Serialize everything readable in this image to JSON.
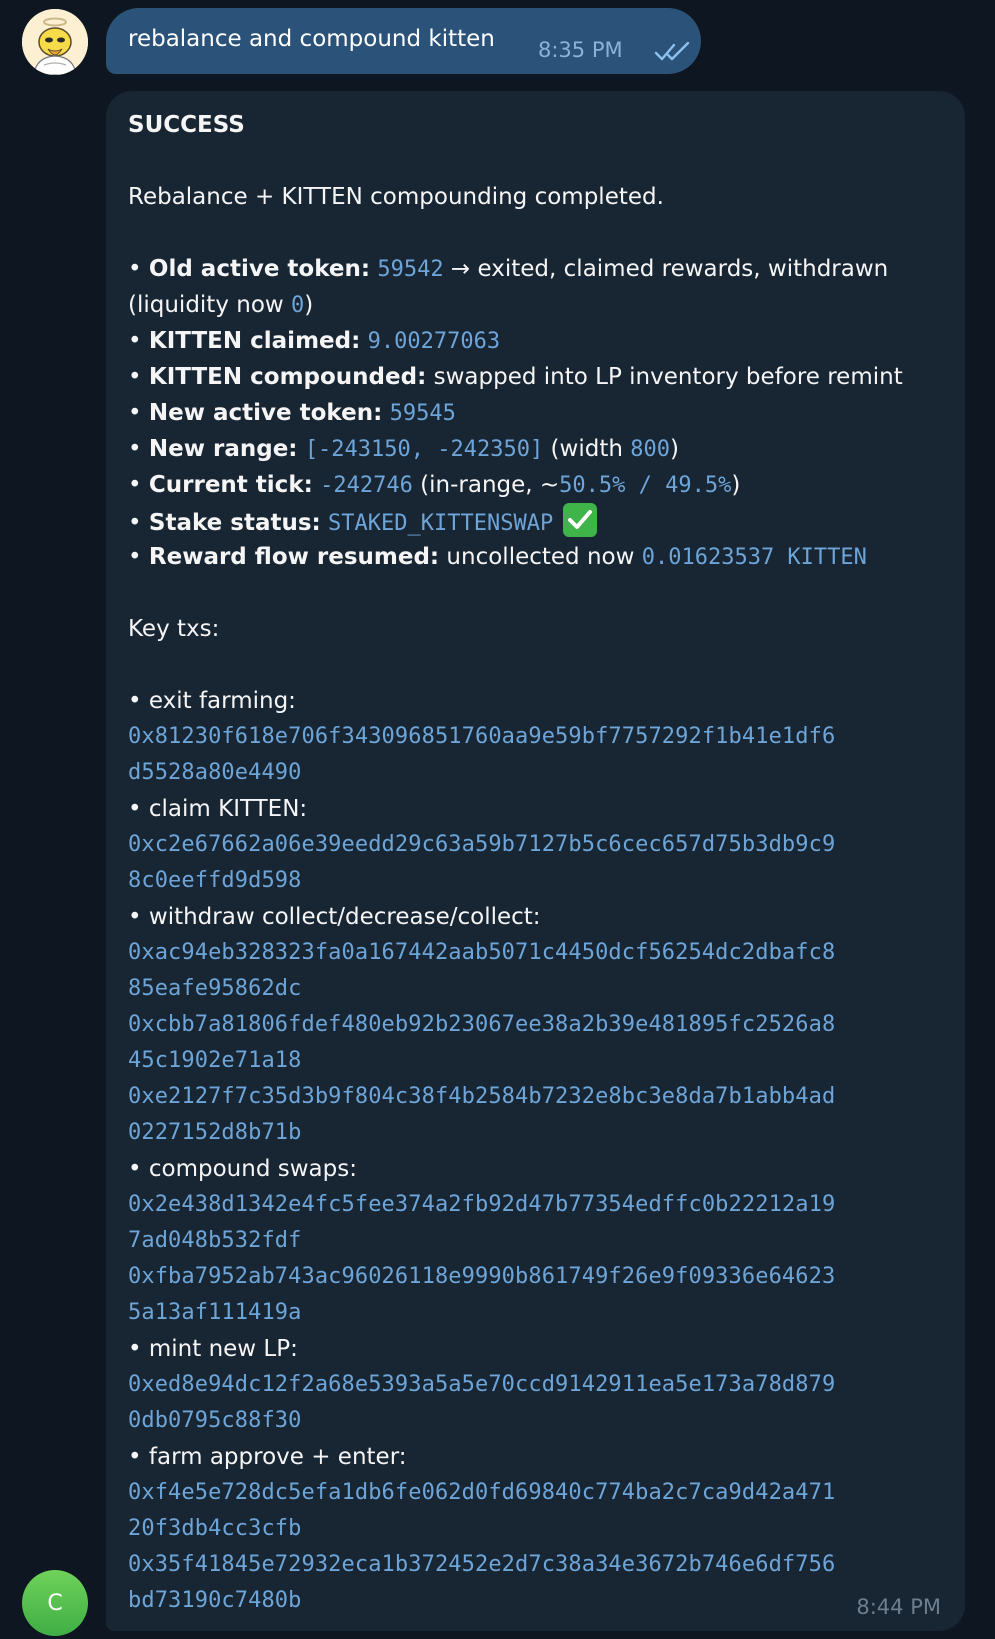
{
  "outgoing": {
    "text": "rebalance and compound kitten",
    "time": "8:35 PM",
    "status_icon": "double-check-icon"
  },
  "incoming": {
    "avatar_letter": "C",
    "time": "8:44 PM",
    "title": "SUCCESS",
    "summary": "Rebalance + KITTEN compounding completed.",
    "bullets": {
      "old_token_label": "Old active token:",
      "old_token_value": "59542",
      "old_token_rest": " → exited, claimed rewards, withdrawn",
      "liquidity_pre": "(liquidity now ",
      "liquidity_value": "0",
      "liquidity_post": ")",
      "claimed_label": "KITTEN claimed:",
      "claimed_value": "9.00277063",
      "compounded_label": "KITTEN compounded:",
      "compounded_rest": " swapped into LP inventory before remint",
      "new_token_label": "New active token:",
      "new_token_value": "59545",
      "range_label": "New range:",
      "range_value": "[-243150, -242350]",
      "range_pre": " (width ",
      "range_width": "800",
      "range_post": ")",
      "tick_label": "Current tick:",
      "tick_value": "-242746",
      "tick_pre": " (in-range, ~",
      "tick_split": "50.5% / 49.5%",
      "tick_post": ")",
      "stake_label": "Stake status:",
      "stake_value": "STAKED_KITTENSWAP",
      "reward_label": "Reward flow resumed:",
      "reward_pre": " uncollected now ",
      "reward_value": "0.01623537 KITTEN"
    },
    "key_txs_heading": "Key txs:",
    "txs": {
      "exit_label": "• exit farming:",
      "exit_hash_1": "0x81230f618e706f343096851760aa9e59bf7757292f1b41e1df6",
      "exit_hash_2": "d5528a80e4490",
      "claim_label": "• claim KITTEN:",
      "claim_hash_1": "0xc2e67662a06e39eedd29c63a59b7127b5c6cec657d75b3db9c9",
      "claim_hash_2": "8c0eeffd9d598",
      "withdraw_label": "• withdraw collect/decrease/collect:",
      "withdraw_hash_a1": "0xac94eb328323fa0a167442aab5071c4450dcf56254dc2dbafc8",
      "withdraw_hash_a2": "85eafe95862dc",
      "withdraw_hash_b1": "0xcbb7a81806fdef480eb92b23067ee38a2b39e481895fc2526a8",
      "withdraw_hash_b2": "45c1902e71a18",
      "withdraw_hash_c1": "0xe2127f7c35d3b9f804c38f4b2584b7232e8bc3e8da7b1abb4ad",
      "withdraw_hash_c2": "0227152d8b71b",
      "swaps_label": "• compound swaps:",
      "swaps_hash_a1": "0x2e438d1342e4fc5fee374a2fb92d47b77354edffc0b22212a19",
      "swaps_hash_a2": "7ad048b532fdf",
      "swaps_hash_b1": "0xfba7952ab743ac96026118e9990b861749f26e9f09336e64623",
      "swaps_hash_b2": "5a13af111419a",
      "mint_label": "• mint new LP:",
      "mint_hash_1": "0xed8e94dc12f2a68e5393a5a5e70ccd9142911ea5e173a78d879",
      "mint_hash_2": "0db0795c88f30",
      "farm_label": "• farm approve + enter:",
      "farm_hash_a1": "0xf4e5e728dc5efa1db6fe062d0fd69840c774ba2c7ca9d42a471",
      "farm_hash_a2": "20f3db4cc3cfb",
      "farm_hash_b1": "0x35f41845e72932eca1b372452e2d7c38a34e3672b746e6df756",
      "farm_hash_b2": "bd73190c7480b"
    }
  },
  "colors": {
    "background": "#0e1621",
    "outgoing_bubble": "#2b5278",
    "incoming_bubble": "#182533",
    "code": "#6ea5d8",
    "check_green": "#3fb449"
  }
}
